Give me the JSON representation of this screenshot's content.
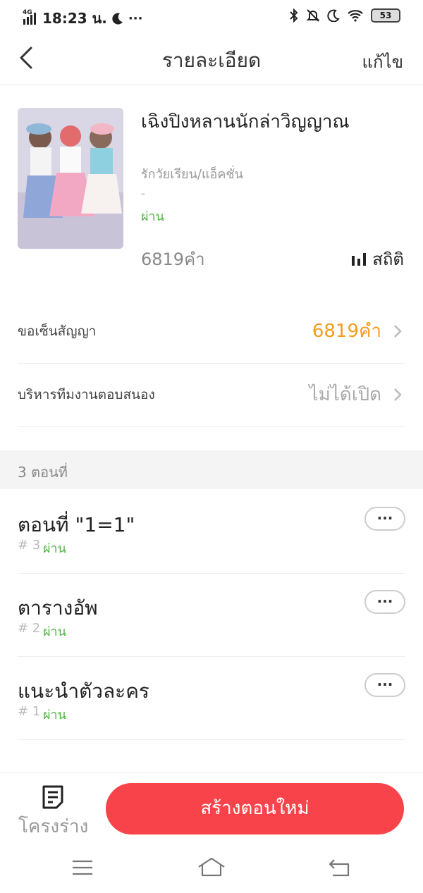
{
  "status_bar": {
    "network": "4G",
    "time": "18:23 น.",
    "battery": "53"
  },
  "header": {
    "title": "รายละเอียด",
    "edit_label": "แก้ไข"
  },
  "book": {
    "title": "เฉิงปิงหลานนักล่าวิญญาณ",
    "genre": "รักวัยเรียน/แอ็คชั่น",
    "dash": "-",
    "status": "ผ่าน",
    "word_count": "6819คำ",
    "stats_label": "สถิติ"
  },
  "rows": [
    {
      "label": "ขอเซ็นสัญญา",
      "value": "6819คำ",
      "value_color": "#f39c1f"
    },
    {
      "label": "บริหารทีมงานตอบสนอง",
      "value": "ไม่ได้เปิด",
      "value_color": "#aaaaaa"
    }
  ],
  "episodes_section": {
    "heading": "3 ตอนที่"
  },
  "episodes": [
    {
      "title": "ตอนที่ \"1=1\"",
      "number": "# 3",
      "status": "ผ่าน",
      "more": "···"
    },
    {
      "title": "ตารางอัพ",
      "number": "# 2",
      "status": "ผ่าน",
      "more": "···"
    },
    {
      "title": "แนะนำตัวละคร",
      "number": "# 1",
      "status": "ผ่าน",
      "more": "···"
    }
  ],
  "action_bar": {
    "draft_label": "โครงร่าง",
    "create_label": "สร้างตอนใหม่"
  },
  "colors": {
    "accent": "#f8434a",
    "status_green": "#4fb341",
    "orange": "#f39c1f"
  }
}
